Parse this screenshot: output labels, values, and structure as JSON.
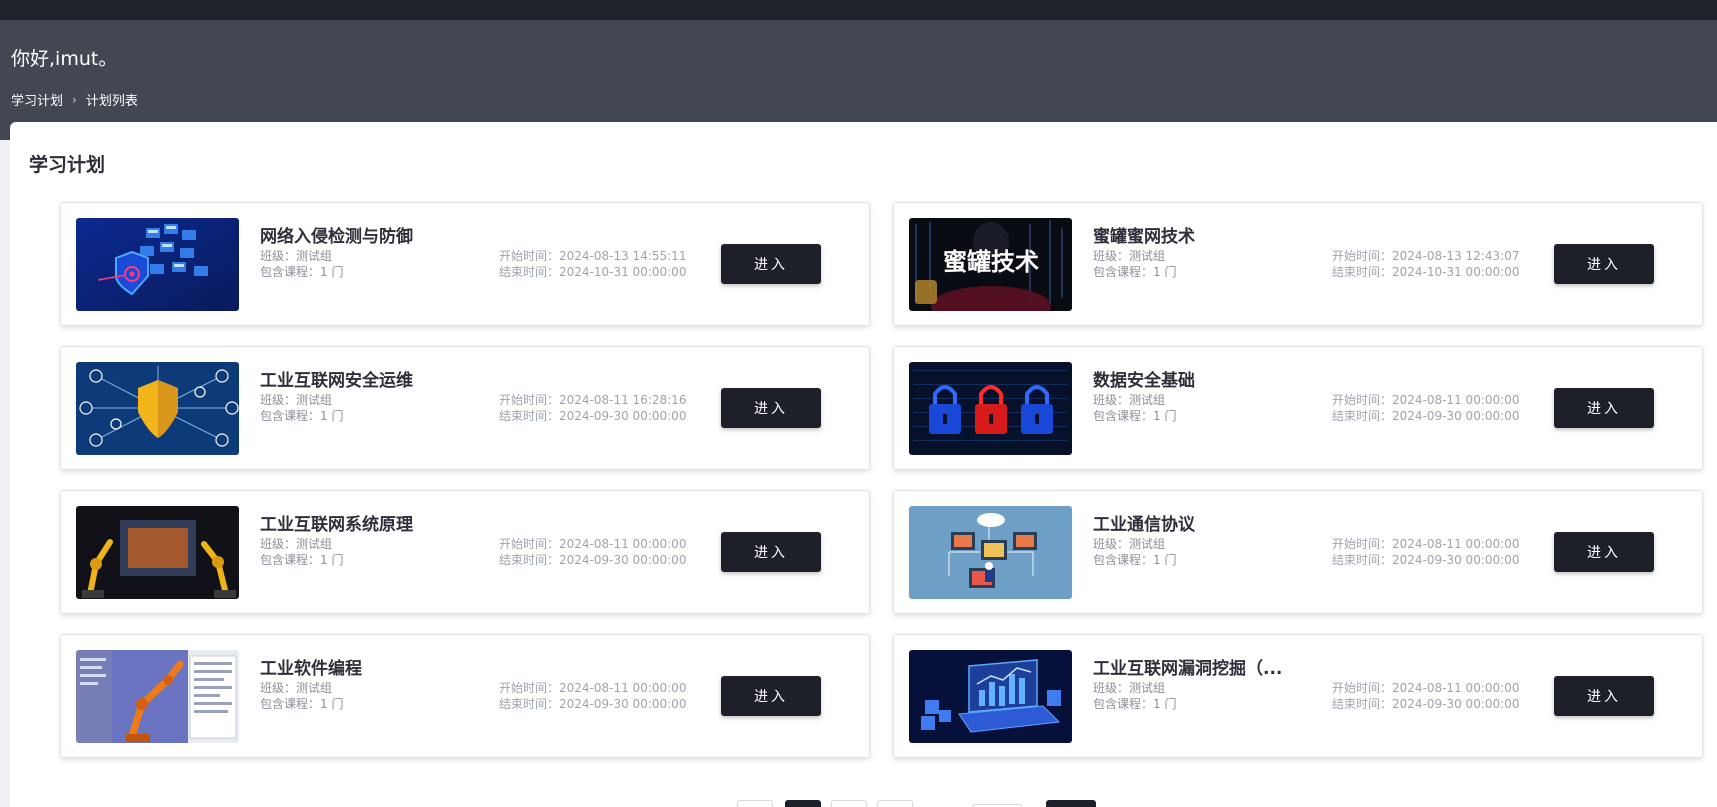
{
  "header": {
    "greeting": "你好,imut。",
    "breadcrumb": [
      "学习计划",
      "计划列表"
    ]
  },
  "main": {
    "title": "学习计划",
    "enter_label": "进入",
    "plans": [
      {
        "title": "网络入侵检测与防御",
        "class_line": "班级：测试组",
        "course_line": "包含课程：1 门",
        "start_line": "开始时间：2024-08-13 14:55:11",
        "end_line": "结束时间：2024-10-31 00:00:00",
        "thumb_icon": "shield-server-image"
      },
      {
        "title": "蜜罐蜜网技术",
        "class_line": "班级：测试组",
        "course_line": "包含课程：1 门",
        "start_line": "开始时间：2024-08-13 12:43:07",
        "end_line": "结束时间：2024-10-31 00:00:00",
        "thumb_icon": "honeypot-image",
        "thumb_text": "蜜罐技术"
      },
      {
        "title": "工业互联网安全运维",
        "class_line": "班级：测试组",
        "course_line": "包含课程：1 门",
        "start_line": "开始时间：2024-08-11 16:28:16",
        "end_line": "结束时间：2024-09-30 00:00:00",
        "thumb_icon": "golden-shield-network-image"
      },
      {
        "title": "数据安全基础",
        "class_line": "班级：测试组",
        "course_line": "包含课程：1 门",
        "start_line": "开始时间：2024-08-11 00:00:00",
        "end_line": "结束时间：2024-09-30 00:00:00",
        "thumb_icon": "padlocks-image"
      },
      {
        "title": "工业互联网系统原理",
        "class_line": "班级：测试组",
        "course_line": "包含课程：1 门",
        "start_line": "开始时间：2024-08-11 00:00:00",
        "end_line": "结束时间：2024-09-30 00:00:00",
        "thumb_icon": "robot-arms-image"
      },
      {
        "title": "工业通信协议",
        "class_line": "班级：测试组",
        "course_line": "包含课程：1 门",
        "start_line": "开始时间：2024-08-11 00:00:00",
        "end_line": "结束时间：2024-09-30 00:00:00",
        "thumb_icon": "network-devices-image"
      },
      {
        "title": "工业软件编程",
        "class_line": "班级：测试组",
        "course_line": "包含课程：1 门",
        "start_line": "开始时间：2024-08-11 00:00:00",
        "end_line": "结束时间：2024-09-30 00:00:00",
        "thumb_icon": "robot-software-image"
      },
      {
        "title": "工业互联网漏洞挖掘（...",
        "class_line": "班级：测试组",
        "course_line": "包含课程：1 门",
        "start_line": "开始时间：2024-08-11 00:00:00",
        "end_line": "结束时间：2024-09-30 00:00:00",
        "thumb_icon": "laptop-data-image"
      }
    ]
  },
  "colors": {
    "topbar": "#1f222b",
    "header": "#434752",
    "button": "#1d2029"
  }
}
